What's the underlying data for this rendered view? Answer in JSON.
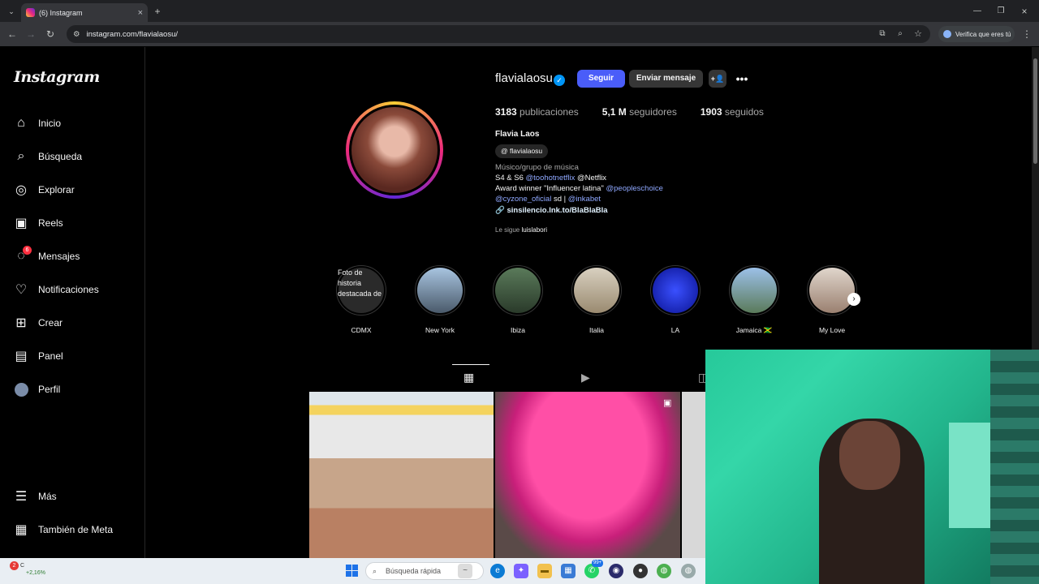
{
  "browser": {
    "tab_title": "(6) Instagram",
    "url": "instagram.com/flavialaosu/",
    "verify_label": "Verifica que eres tú"
  },
  "sidebar": {
    "logo": "Instagram",
    "items": [
      {
        "label": "Inicio",
        "icon": "home-icon"
      },
      {
        "label": "Búsqueda",
        "icon": "search-icon"
      },
      {
        "label": "Explorar",
        "icon": "compass-icon"
      },
      {
        "label": "Reels",
        "icon": "reels-icon"
      },
      {
        "label": "Mensajes",
        "icon": "messenger-icon",
        "badge": "6"
      },
      {
        "label": "Notificaciones",
        "icon": "heart-icon"
      },
      {
        "label": "Crear",
        "icon": "plus-square-icon"
      },
      {
        "label": "Panel",
        "icon": "chart-icon"
      },
      {
        "label": "Perfil",
        "icon": "avatar-icon"
      }
    ],
    "bottom": [
      {
        "label": "Más",
        "icon": "menu-icon"
      },
      {
        "label": "También de Meta",
        "icon": "meta-grid-icon"
      }
    ]
  },
  "profile": {
    "username": "flavialaosu",
    "follow_label": "Seguir",
    "message_label": "Enviar mensaje",
    "posts_count": "3183",
    "posts_label": "publicaciones",
    "followers_count": "5,1 M",
    "followers_label": "seguidores",
    "following_count": "1903",
    "following_label": "seguidos",
    "full_name": "Flavia Laos",
    "threads_handle": "flavialaosu",
    "category": "Músico/grupo de música",
    "bio_line1_a": "S4 & S6 ",
    "bio_line1_mention": "@toohotnetflix",
    "bio_line1_b": " @Netflix",
    "bio_line2_a": "Award winner \"Influencer latina\" ",
    "bio_line2_mention": "@peopleschoice",
    "bio_line3_mention1": "@cyzone_oficial",
    "bio_line3_b": " sd | ",
    "bio_line3_mention2": "@inkabet",
    "link": "sinsilencio.lnk.to/BlaBlaBla",
    "followed_by_prefix": "Le sigue",
    "followed_by_user": "luislabori"
  },
  "highlights": [
    {
      "label": "CDMX",
      "color": "#3a3a3a"
    },
    {
      "label": "New York",
      "color": "#6f8fb0"
    },
    {
      "label": "Ibiza",
      "color": "#4a6a4a"
    },
    {
      "label": "Italia",
      "color": "#b7a890"
    },
    {
      "label": "LA",
      "color": "#1a2fd0"
    },
    {
      "label": "Jamaica 🇯🇲",
      "color": "#7ea4c8"
    },
    {
      "label": "My Love",
      "color": "#cdb8a8"
    }
  ],
  "cdmx_alt": "Foto de historia destacada de",
  "taskbar": {
    "weather_badge": "2",
    "weather_temp": "C",
    "weather_change": "+2,16%",
    "search_placeholder": "Búsqueda rápida",
    "whatsapp_badge": "99+"
  }
}
